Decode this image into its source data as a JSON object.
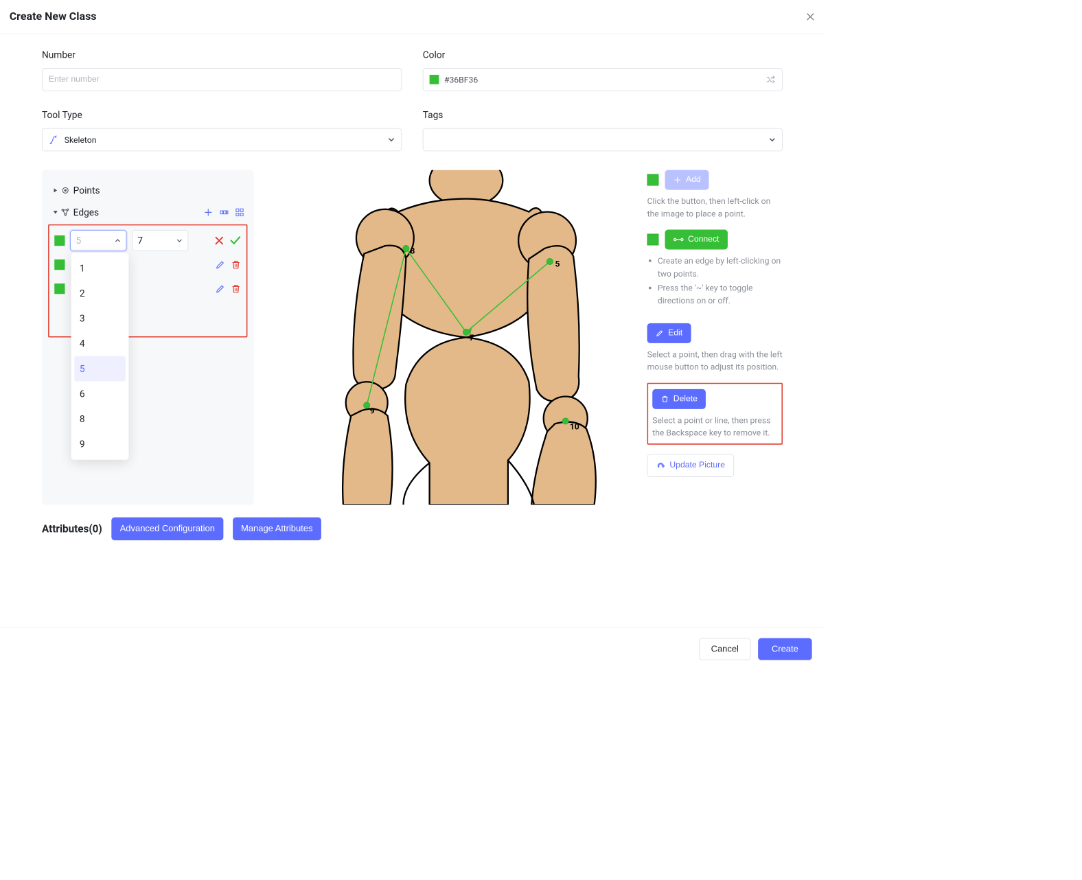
{
  "title": "Create New Class",
  "fields": {
    "number_label": "Number",
    "number_placeholder": "Enter number",
    "color_label": "Color",
    "color_value": "#36BF36",
    "tooltype_label": "Tool Type",
    "tooltype_value": "Skeleton",
    "tags_label": "Tags"
  },
  "tree": {
    "points_label": "Points",
    "edges_label": "Edges"
  },
  "edge_editor": {
    "from_value": "5",
    "to_value": "7",
    "options": [
      "1",
      "2",
      "3",
      "4",
      "5",
      "6",
      "8",
      "9"
    ],
    "selected_option": "5"
  },
  "canvas_points": {
    "p5": "5",
    "p7": "7",
    "p8": "8",
    "p9": "9",
    "p10": "10"
  },
  "right": {
    "add_label": "Add",
    "add_help": "Click the button, then left-click on the image to place a point.",
    "connect_label": "Connect",
    "connect_help_1": "Create an edge by left-clicking on two points.",
    "connect_help_2": "Press the '~' key to toggle directions on or off.",
    "edit_label": "Edit",
    "edit_help": "Select a point, then drag with the left mouse button to adjust its position.",
    "delete_label": "Delete",
    "delete_help": "Select a point or line, then press the Backspace key to remove it.",
    "update_label": "Update Picture"
  },
  "attrs": {
    "title": "Attributes(0)",
    "advanced": "Advanced Configuration",
    "manage": "Manage Attributes"
  },
  "footer": {
    "cancel": "Cancel",
    "create": "Create"
  }
}
